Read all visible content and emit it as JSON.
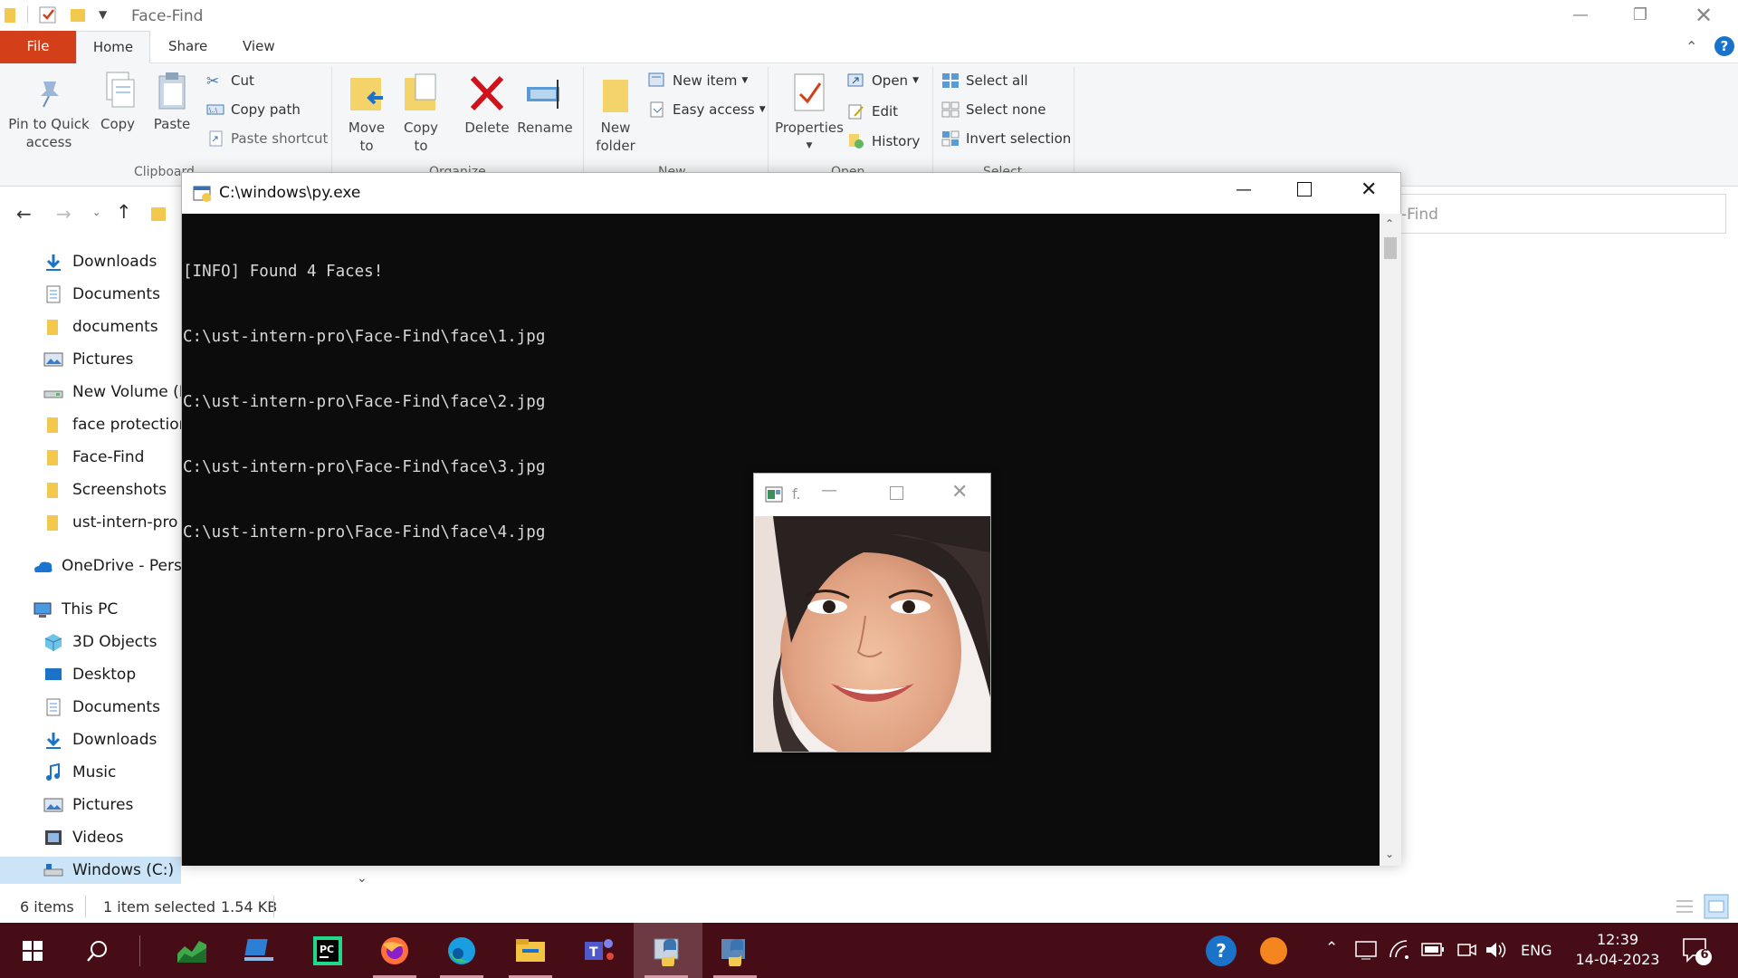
{
  "explorer": {
    "title": "Face-Find",
    "tabs": {
      "file": "File",
      "home": "Home",
      "share": "Share",
      "view": "View"
    },
    "ribbon": {
      "pin": "Pin to Quick access",
      "copy": "Copy",
      "paste": "Paste",
      "cut": "Cut",
      "copy_path": "Copy path",
      "paste_shortcut": "Paste shortcut",
      "move_to": "Move to",
      "copy_to": "Copy to",
      "delete": "Delete",
      "rename": "Rename",
      "new_folder": "New folder",
      "new_item": "New item",
      "easy_access": "Easy access",
      "properties": "Properties",
      "open": "Open",
      "edit": "Edit",
      "history": "History",
      "select_all": "Select all",
      "select_none": "Select none",
      "invert_selection": "Invert selection",
      "groups": {
        "clipboard": "Clipboard",
        "organize": "Organize",
        "new": "New",
        "open": "Open",
        "select": "Select"
      }
    },
    "search_placeholder": "-Find",
    "nav": [
      {
        "label": "Downloads",
        "icon": "download-arrow-icon"
      },
      {
        "label": "Documents",
        "icon": "documents-icon"
      },
      {
        "label": "documents",
        "icon": "folder-icon"
      },
      {
        "label": "Pictures",
        "icon": "pictures-icon"
      },
      {
        "label": "New Volume (D",
        "icon": "drive-icon"
      },
      {
        "label": "face protection",
        "icon": "folder-icon"
      },
      {
        "label": "Face-Find",
        "icon": "folder-icon"
      },
      {
        "label": "Screenshots",
        "icon": "folder-icon"
      },
      {
        "label": "ust-intern-pro",
        "icon": "folder-icon"
      },
      {
        "label": "OneDrive - Perso",
        "icon": "onedrive-icon"
      },
      {
        "label": "This PC",
        "icon": "computer-icon"
      },
      {
        "label": "3D Objects",
        "icon": "3d-objects-icon"
      },
      {
        "label": "Desktop",
        "icon": "desktop-icon"
      },
      {
        "label": "Documents",
        "icon": "documents-icon"
      },
      {
        "label": "Downloads",
        "icon": "download-arrow-icon"
      },
      {
        "label": "Music",
        "icon": "music-icon"
      },
      {
        "label": "Pictures",
        "icon": "pictures-icon"
      },
      {
        "label": "Videos",
        "icon": "videos-icon"
      },
      {
        "label": "Windows (C:)",
        "icon": "drive-c-icon"
      }
    ],
    "status": {
      "items": "6 items",
      "selected": "1 item selected",
      "size": "1.54 KB"
    }
  },
  "console": {
    "title": "C:\\windows\\py.exe",
    "lines": [
      "[INFO] Found 4 Faces!",
      "C:\\ust-intern-pro\\Face-Find\\face\\1.jpg",
      "C:\\ust-intern-pro\\Face-Find\\face\\2.jpg",
      "C:\\ust-intern-pro\\Face-Find\\face\\3.jpg",
      "C:\\ust-intern-pro\\Face-Find\\face\\4.jpg"
    ]
  },
  "face_window": {
    "title": "f."
  },
  "taskbar": {
    "time": "12:39",
    "date": "14-04-2023",
    "lang": "ENG",
    "notification_count": "6",
    "colors": {
      "background": "#470d17",
      "accent": "#d23f18"
    }
  }
}
